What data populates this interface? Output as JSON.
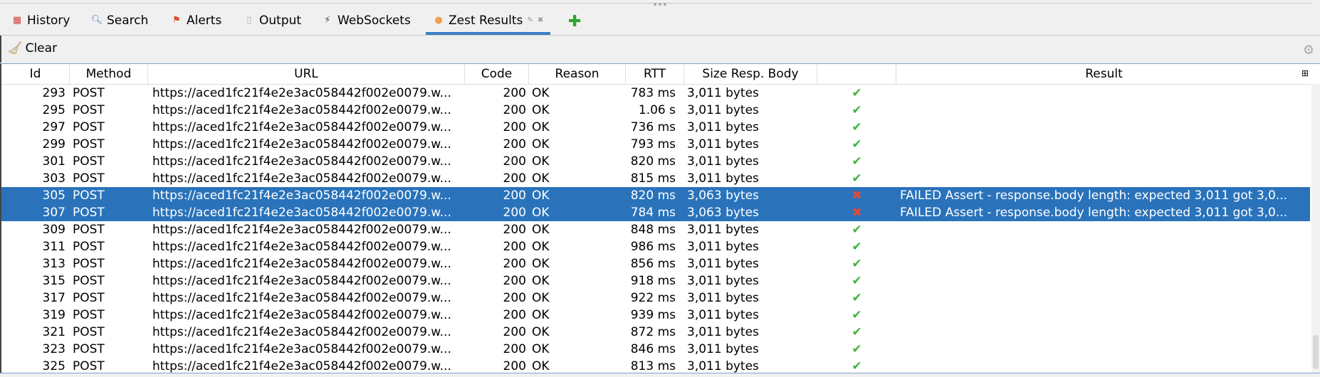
{
  "tabs": [
    {
      "label": "History",
      "icon": "calendar-icon"
    },
    {
      "label": "Search",
      "icon": "magnifier-icon"
    },
    {
      "label": "Alerts",
      "icon": "flag-icon"
    },
    {
      "label": "Output",
      "icon": "document-icon"
    },
    {
      "label": "WebSockets",
      "icon": "plug-icon"
    },
    {
      "label": "Zest Results",
      "icon": "zest-icon",
      "active": true
    }
  ],
  "toolbar": {
    "clear_label": "Clear"
  },
  "columns": [
    "Id",
    "Method",
    "URL",
    "Code",
    "Reason",
    "RTT",
    "Size Resp. Body",
    "",
    "Result"
  ],
  "rows": [
    {
      "id": "293",
      "method": "POST",
      "url": "https://aced1fc21f4e2e3ac058442f002e0079.w...",
      "code": "200",
      "reason": "OK",
      "rtt": "783 ms",
      "size": "3,011 bytes",
      "status": "pass",
      "result": ""
    },
    {
      "id": "295",
      "method": "POST",
      "url": "https://aced1fc21f4e2e3ac058442f002e0079.w...",
      "code": "200",
      "reason": "OK",
      "rtt": "1.06 s",
      "size": "3,011 bytes",
      "status": "pass",
      "result": ""
    },
    {
      "id": "297",
      "method": "POST",
      "url": "https://aced1fc21f4e2e3ac058442f002e0079.w...",
      "code": "200",
      "reason": "OK",
      "rtt": "736 ms",
      "size": "3,011 bytes",
      "status": "pass",
      "result": ""
    },
    {
      "id": "299",
      "method": "POST",
      "url": "https://aced1fc21f4e2e3ac058442f002e0079.w...",
      "code": "200",
      "reason": "OK",
      "rtt": "793 ms",
      "size": "3,011 bytes",
      "status": "pass",
      "result": ""
    },
    {
      "id": "301",
      "method": "POST",
      "url": "https://aced1fc21f4e2e3ac058442f002e0079.w...",
      "code": "200",
      "reason": "OK",
      "rtt": "820 ms",
      "size": "3,011 bytes",
      "status": "pass",
      "result": ""
    },
    {
      "id": "303",
      "method": "POST",
      "url": "https://aced1fc21f4e2e3ac058442f002e0079.w...",
      "code": "200",
      "reason": "OK",
      "rtt": "815 ms",
      "size": "3,011 bytes",
      "status": "pass",
      "result": ""
    },
    {
      "id": "305",
      "method": "POST",
      "url": "https://aced1fc21f4e2e3ac058442f002e0079.w...",
      "code": "200",
      "reason": "OK",
      "rtt": "820 ms",
      "size": "3,063 bytes",
      "status": "fail",
      "result": "FAILED Assert - response.body length: expected 3,011 got 3,0...",
      "selected": true
    },
    {
      "id": "307",
      "method": "POST",
      "url": "https://aced1fc21f4e2e3ac058442f002e0079.w...",
      "code": "200",
      "reason": "OK",
      "rtt": "784 ms",
      "size": "3,063 bytes",
      "status": "fail",
      "result": "FAILED Assert - response.body length: expected 3,011 got 3,0...",
      "selected": true
    },
    {
      "id": "309",
      "method": "POST",
      "url": "https://aced1fc21f4e2e3ac058442f002e0079.w...",
      "code": "200",
      "reason": "OK",
      "rtt": "848 ms",
      "size": "3,011 bytes",
      "status": "pass",
      "result": ""
    },
    {
      "id": "311",
      "method": "POST",
      "url": "https://aced1fc21f4e2e3ac058442f002e0079.w...",
      "code": "200",
      "reason": "OK",
      "rtt": "986 ms",
      "size": "3,011 bytes",
      "status": "pass",
      "result": ""
    },
    {
      "id": "313",
      "method": "POST",
      "url": "https://aced1fc21f4e2e3ac058442f002e0079.w...",
      "code": "200",
      "reason": "OK",
      "rtt": "856 ms",
      "size": "3,011 bytes",
      "status": "pass",
      "result": ""
    },
    {
      "id": "315",
      "method": "POST",
      "url": "https://aced1fc21f4e2e3ac058442f002e0079.w...",
      "code": "200",
      "reason": "OK",
      "rtt": "918 ms",
      "size": "3,011 bytes",
      "status": "pass",
      "result": ""
    },
    {
      "id": "317",
      "method": "POST",
      "url": "https://aced1fc21f4e2e3ac058442f002e0079.w...",
      "code": "200",
      "reason": "OK",
      "rtt": "922 ms",
      "size": "3,011 bytes",
      "status": "pass",
      "result": ""
    },
    {
      "id": "319",
      "method": "POST",
      "url": "https://aced1fc21f4e2e3ac058442f002e0079.w...",
      "code": "200",
      "reason": "OK",
      "rtt": "939 ms",
      "size": "3,011 bytes",
      "status": "pass",
      "result": ""
    },
    {
      "id": "321",
      "method": "POST",
      "url": "https://aced1fc21f4e2e3ac058442f002e0079.w...",
      "code": "200",
      "reason": "OK",
      "rtt": "872 ms",
      "size": "3,011 bytes",
      "status": "pass",
      "result": ""
    },
    {
      "id": "323",
      "method": "POST",
      "url": "https://aced1fc21f4e2e3ac058442f002e0079.w...",
      "code": "200",
      "reason": "OK",
      "rtt": "846 ms",
      "size": "3,011 bytes",
      "status": "pass",
      "result": ""
    },
    {
      "id": "325",
      "method": "POST",
      "url": "https://aced1fc21f4e2e3ac058442f002e0079.w...",
      "code": "200",
      "reason": "OK",
      "rtt": "813 ms",
      "size": "3,011 bytes",
      "status": "pass",
      "result": ""
    }
  ],
  "colors": {
    "selection": "#2a73bb",
    "active_tab": "#3e7fc4",
    "pass": "#3fb33f",
    "fail": "#e04a3a"
  }
}
